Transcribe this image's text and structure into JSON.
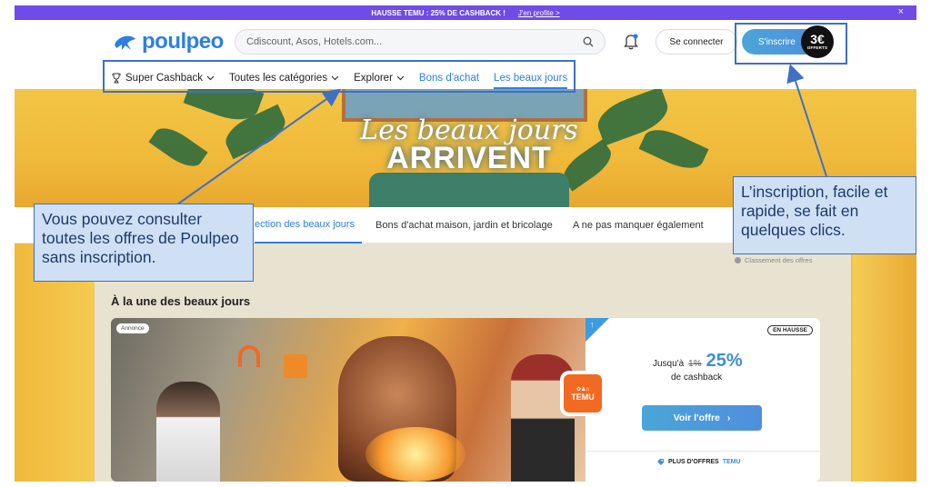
{
  "promo_bar": {
    "text": "HAUSSE TEMU : 25% DE CASHBACK !",
    "link": "J'en profite >",
    "close": "×"
  },
  "header": {
    "logo_text": "poulpeo",
    "search_placeholder": "Cdiscount, Asos, Hotels.com...",
    "login_label": "Se connecter",
    "signup_label": "S'inscrire",
    "signup_bonus_amount": "3€",
    "signup_bonus_label": "OFFERTS"
  },
  "nav": {
    "items": [
      {
        "label": "Super Cashback"
      },
      {
        "label": "Toutes les catégories"
      },
      {
        "label": "Explorer"
      },
      {
        "label": "Bons d'achat"
      },
      {
        "label": "Les beaux jours"
      }
    ]
  },
  "hero": {
    "line1": "Les beaux jours",
    "line2": "ARRIVENT"
  },
  "tabs": {
    "items": [
      {
        "label": "ection des beaux jours"
      },
      {
        "label": "Bons d'achat maison, jardin et bricolage"
      },
      {
        "label": "A ne pas manquer également"
      }
    ]
  },
  "content": {
    "ranking_label": "Classement des offres",
    "section_title": "À la une des beaux jours",
    "card": {
      "ad_label": "Annonce",
      "badge": "EN HAUSSE",
      "prefix": "Jusqu'à",
      "old_rate": "1%",
      "rate": "25%",
      "suffix": "de cashback",
      "brand_logo": "TEMU",
      "cta": "Voir l'offre",
      "more_prefix": "PLUS D'OFFRES",
      "more_brand": "TEMU"
    }
  },
  "annotations": {
    "left": "Vous pouvez consulter toutes les offres de Poulpeo sans inscription.",
    "right": "L’inscription, facile et rapide, se fait en quelques clics."
  },
  "colors": {
    "accent_blue": "#2d7fe0",
    "promo_purple": "#6f4be8",
    "callout_border": "#3f70c4",
    "callout_fill": "#cfe0f5",
    "temu_orange": "#f26a21"
  }
}
